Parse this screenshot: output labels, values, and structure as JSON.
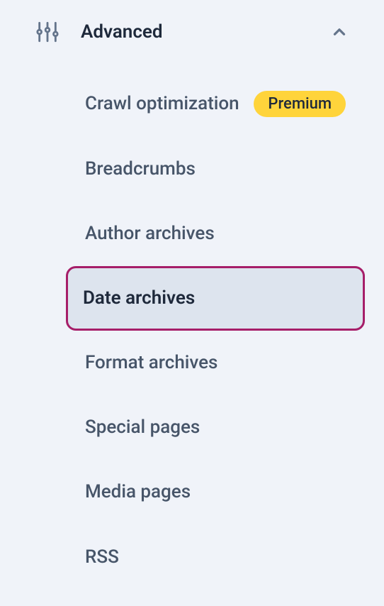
{
  "section": {
    "title": "Advanced"
  },
  "menu": {
    "items": [
      {
        "label": "Crawl optimization",
        "badge": "Premium",
        "selected": false
      },
      {
        "label": "Breadcrumbs",
        "badge": null,
        "selected": false
      },
      {
        "label": "Author archives",
        "badge": null,
        "selected": false
      },
      {
        "label": "Date archives",
        "badge": null,
        "selected": true
      },
      {
        "label": "Format archives",
        "badge": null,
        "selected": false
      },
      {
        "label": "Special pages",
        "badge": null,
        "selected": false
      },
      {
        "label": "Media pages",
        "badge": null,
        "selected": false
      },
      {
        "label": "RSS",
        "badge": null,
        "selected": false
      }
    ]
  }
}
